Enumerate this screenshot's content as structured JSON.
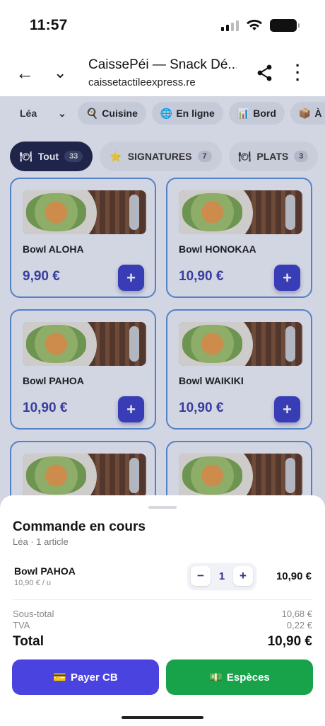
{
  "status": {
    "time": "11:57"
  },
  "browser": {
    "title": "CaissePéi — Snack Dé...",
    "url": "caissetactileexpress.re"
  },
  "filters": {
    "seller": "Léa",
    "chips": [
      {
        "icon": "🍳",
        "label": "Cuisine"
      },
      {
        "icon": "🌐",
        "label": "En ligne"
      },
      {
        "icon": "📊",
        "label": "Bord"
      },
      {
        "icon": "📦",
        "label": "À reti"
      }
    ]
  },
  "tabs": [
    {
      "icon": "🍽",
      "label": "Tout",
      "count": "33"
    },
    {
      "icon": "⭐",
      "label": "SIGNATURES",
      "count": "7"
    },
    {
      "icon": "🍽",
      "label": "PLATS",
      "count": "3"
    }
  ],
  "products": [
    {
      "name": "Bowl ALOHA",
      "price": "9,90 €"
    },
    {
      "name": "Bowl HONOKAA",
      "price": "10,90 €"
    },
    {
      "name": "Bowl PAHOA",
      "price": "10,90 €"
    },
    {
      "name": "Bowl WAIKIKI",
      "price": "10,90 €"
    }
  ],
  "order": {
    "title": "Commande en cours",
    "subtitle": "Léa · 1 article",
    "item": {
      "name": "Bowl PAHOA",
      "unit_price": "10,90 € / u",
      "qty": "1",
      "line_total": "10,90 €"
    },
    "subtotal_label": "Sous-total",
    "subtotal": "10,68 €",
    "tva_label": "TVA",
    "tva": "0,22 €",
    "total_label": "Total",
    "total": "10,90 €",
    "pay_card_icon": "💳",
    "pay_card": "Payer CB",
    "pay_cash_icon": "💵",
    "pay_cash": "Espèces"
  }
}
